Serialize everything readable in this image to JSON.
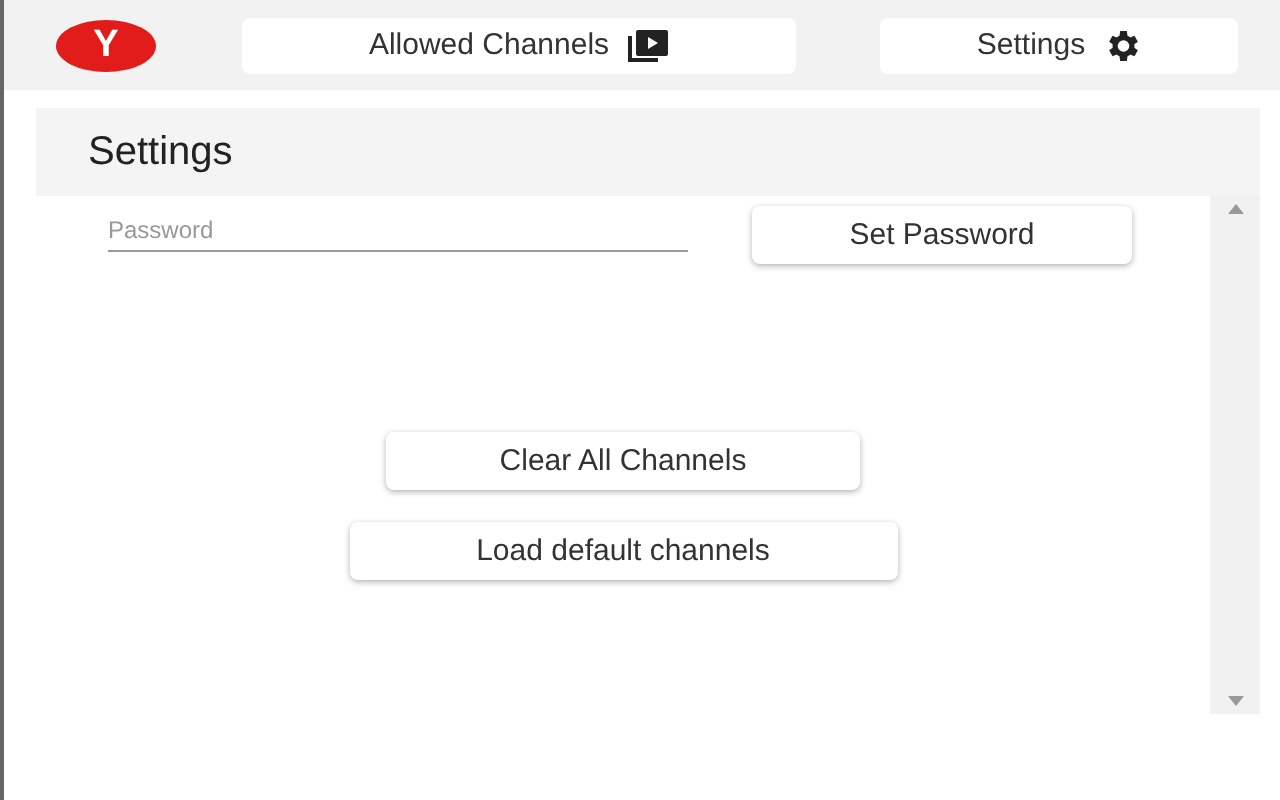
{
  "logo": {
    "letter": "Y"
  },
  "nav": [
    {
      "label": "Allowed Channels"
    },
    {
      "label": "Settings"
    }
  ],
  "panel": {
    "title": "Settings",
    "password": {
      "placeholder": "Password"
    },
    "set_button": "Set Password",
    "actions": [
      "Clear All Channels",
      "Load default channels"
    ]
  }
}
